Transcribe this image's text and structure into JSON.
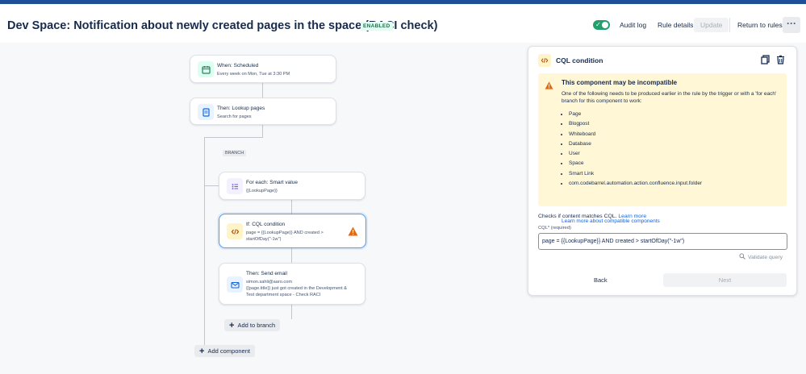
{
  "header": {
    "title": "Dev Space: Notification about newly created pages in the space (RACI check)",
    "status": "ENABLED",
    "audit_log": "Audit log",
    "rule_details": "Rule details",
    "update": "Update",
    "return_to_rules": "Return to rules",
    "more": "···",
    "toggle_check": "✓"
  },
  "flow": {
    "trigger": {
      "title": "When: Scheduled",
      "subtitle": "Every week on Mon, Tue at 3:30 PM"
    },
    "lookup": {
      "title": "Then: Lookup pages",
      "subtitle": "Search for pages"
    },
    "branch_label": "BRANCH",
    "for_each": {
      "title": "For each: Smart value",
      "subtitle": "{{LookupPage}}"
    },
    "if_cql": {
      "title": "If: CQL condition",
      "subtitle_1": "page = {{LookupPage}} AND created >",
      "subtitle_2": "startOfDay(\"-1w\")"
    },
    "send_email": {
      "title": "Then: Send email",
      "line_1": "simon.sahli@aaro.com",
      "line_2": "{{page.title}} just got created in the Development &",
      "line_3": "Test department space - Check RACI"
    },
    "add_to_branch": "Add to branch",
    "add_component": "Add component"
  },
  "panel": {
    "title": "CQL condition",
    "warning": {
      "title": "This component may be incompatible",
      "description": "One of the following needs to be produced earlier in the rule by the trigger or with a 'for each' branch for this component to work:",
      "items": [
        "Page",
        "Blogpost",
        "Whiteboard",
        "Database",
        "User",
        "Space",
        "Smart Link",
        "com.codebarrel.automation.action.confluence.input.folder"
      ],
      "link": "Learn more about compatible components"
    },
    "checks_text": "Checks if content matches CQL.",
    "checks_link": "Learn more",
    "field_label": "CQL* (required)",
    "cql_value": "page = {{LookupPage}} AND created > startOfDay(\"-1w\")",
    "validate": "Validate query",
    "back": "Back",
    "next": "Next"
  },
  "colors": {
    "accent": "#0c66e4",
    "enabled": "#22a06b",
    "warning_bg": "#fff7d6",
    "topbar": "#1f4f99"
  }
}
